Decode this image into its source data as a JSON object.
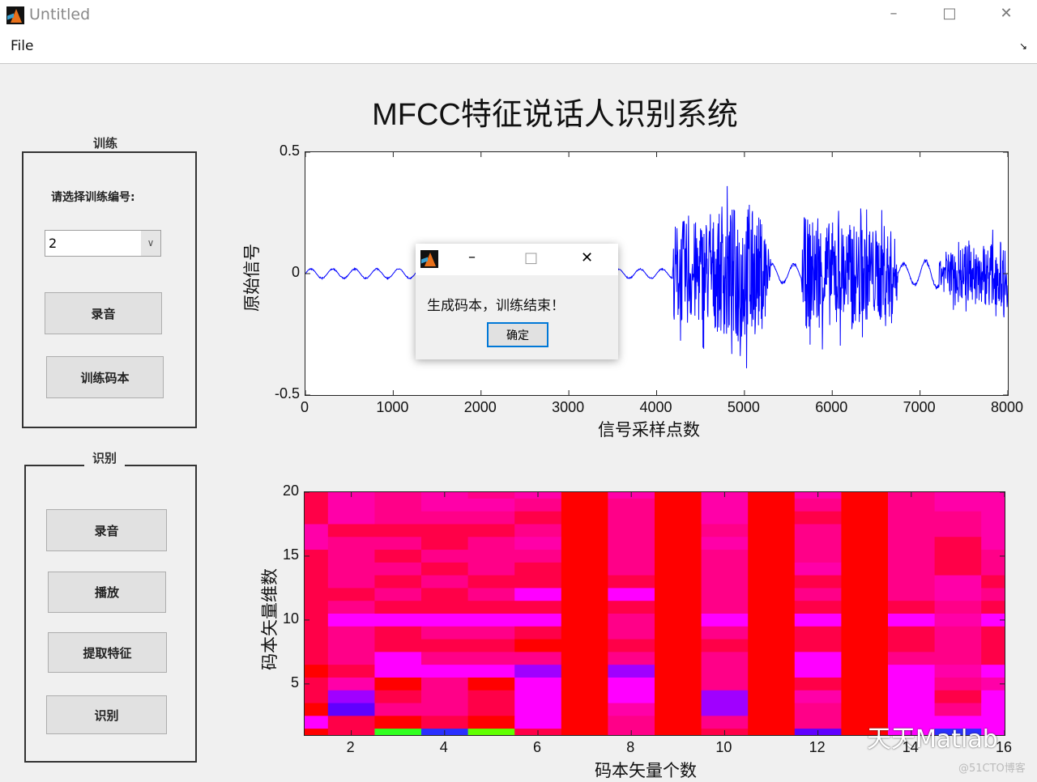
{
  "window": {
    "title": "Untitled",
    "menu": [
      "File"
    ],
    "controls": [
      "minimize-icon",
      "maximize-icon",
      "close-icon"
    ]
  },
  "main_title": "MFCC特征说话人识别系统",
  "train_panel": {
    "title": "训练",
    "prompt": "请选择训练编号:",
    "dropdown_value": "2",
    "buttons": [
      "录音",
      "训练码本"
    ]
  },
  "recognize_panel": {
    "title": "识别",
    "buttons": [
      "录音",
      "播放",
      "提取特征",
      "识别"
    ]
  },
  "dialog": {
    "message": "生成码本，训练结束！",
    "ok_label": "确定"
  },
  "watermark": {
    "text": "天天Matlab",
    "source": "@51CTO博客"
  },
  "chart_data": [
    {
      "type": "line",
      "xlabel": "信号采样点数",
      "ylabel": "原始信号",
      "xlim": [
        0,
        8000
      ],
      "ylim": [
        -0.5,
        0.5
      ],
      "xticks": [
        "0",
        "1000",
        "2000",
        "3000",
        "4000",
        "5000",
        "6000",
        "7000",
        "8000"
      ],
      "yticks": [
        "-0.5",
        "0",
        "0.5"
      ],
      "color": "#0000ff",
      "envelope": [
        [
          0,
          0.02
        ],
        [
          4180,
          0.02
        ],
        [
          4200,
          0.3
        ],
        [
          4600,
          0.32
        ],
        [
          5000,
          0.43
        ],
        [
          5250,
          0.3
        ],
        [
          5300,
          0.04
        ],
        [
          5650,
          0.04
        ],
        [
          5680,
          0.33
        ],
        [
          6700,
          0.26
        ],
        [
          6760,
          0.04
        ],
        [
          7200,
          0.06
        ],
        [
          7400,
          0.16
        ],
        [
          8000,
          0.2
        ]
      ]
    },
    {
      "type": "heatmap",
      "xlabel": "码本矢量个数",
      "ylabel": "码本矢量维数",
      "xlim": [
        1,
        16
      ],
      "ylim": [
        1,
        20
      ],
      "xticks": [
        "2",
        "4",
        "6",
        "8",
        "10",
        "12",
        "14",
        "16"
      ],
      "yticks": [
        "5",
        "10",
        "15",
        "20"
      ],
      "palette": {
        "R": "#ff0000",
        "r": "#ff0048",
        "p": "#ff0088",
        "q": "#ff00a8",
        "m": "#ff00ff",
        "v": "#a000ff",
        "u": "#6000ff",
        "b": "#2a30ff",
        "g": "#30ff20",
        "G": "#60ff00"
      },
      "rows_top_to_bottom": [
        "rqpqpqRqRqRqRpqq",
        "rqpqqpRpRqRpRpqq",
        "rqppprRpRqRrRppq",
        "qrrrrpRpRpRpRppq",
        "qpprpqRpRqRpRprq",
        "rprpppRpRpRpRprp",
        "rpprprRpRpRqRprp",
        "rprprrRrRpRrRpqr",
        "rrprpmRmRpRpRpqp",
        "rprrrrRrRpRrRrpr",
        "rmmmmmRpRmRmRmqm",
        "rprpprRpRpRrRrpr",
        "rprrrRRrRrRrRrpr",
        "rpmpppRpRpRmRppr",
        "RrmmmvRvRpRmRmqm",
        "rqRpRmRmRpRrRmpq",
        "rvrprmRmRvRqRmrm",
        "RupprmRqRvRpRmpm",
        "mrRrRmRpRpRpRmmm",
        "RrgbGrRpRrRuRmbm"
      ]
    }
  ]
}
